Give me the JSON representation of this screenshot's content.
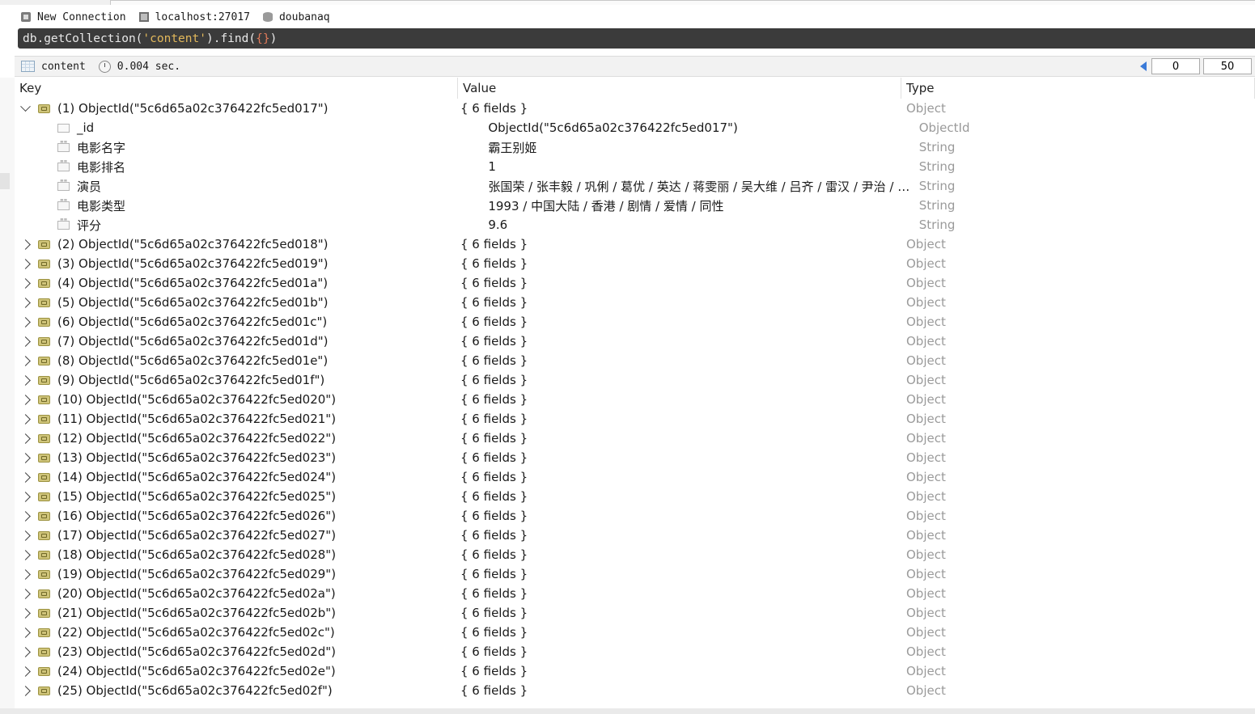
{
  "connection": {
    "name": "New Connection",
    "host": "localhost:27017",
    "database": "doubanaq"
  },
  "query": {
    "prefix": "db.getCollection(",
    "arg": "'content'",
    "mid": ").find(",
    "open_brace": "{",
    "close_brace": "}",
    "suffix": ")"
  },
  "result": {
    "collection": "content",
    "time": "0.004 sec.",
    "page_start": "0",
    "page_size": "50"
  },
  "columns": {
    "key": "Key",
    "value": "Value",
    "type": "Type"
  },
  "expanded_document": {
    "key": "(1) ObjectId(\"5c6d65a02c376422fc5ed017\")",
    "value": "{ 6 fields }",
    "type": "Object",
    "fields": [
      {
        "key": "_id",
        "value": "ObjectId(\"5c6d65a02c376422fc5ed017\")",
        "type": "ObjectId",
        "icon": "id-icon"
      },
      {
        "key": "电影名字",
        "value": "霸王别姬",
        "type": "String",
        "icon": "string-icon"
      },
      {
        "key": "电影排名",
        "value": "1",
        "type": "String",
        "icon": "string-icon"
      },
      {
        "key": "演员",
        "value": "张国荣 / 张丰毅 / 巩俐 / 葛优 / 英达 / 蒋雯丽 / 吴大维 / 吕齐 / 雷汉 / 尹治 / 马…",
        "type": "String",
        "icon": "string-icon"
      },
      {
        "key": "电影类型",
        "value": "1993 / 中国大陆 / 香港 / 剧情 / 爱情 / 同性",
        "type": "String",
        "icon": "string-icon"
      },
      {
        "key": "评分",
        "value": "9.6",
        "type": "String",
        "icon": "string-icon"
      }
    ]
  },
  "documents": [
    {
      "key": "(2) ObjectId(\"5c6d65a02c376422fc5ed018\")",
      "value": "{ 6 fields }",
      "type": "Object"
    },
    {
      "key": "(3) ObjectId(\"5c6d65a02c376422fc5ed019\")",
      "value": "{ 6 fields }",
      "type": "Object"
    },
    {
      "key": "(4) ObjectId(\"5c6d65a02c376422fc5ed01a\")",
      "value": "{ 6 fields }",
      "type": "Object"
    },
    {
      "key": "(5) ObjectId(\"5c6d65a02c376422fc5ed01b\")",
      "value": "{ 6 fields }",
      "type": "Object"
    },
    {
      "key": "(6) ObjectId(\"5c6d65a02c376422fc5ed01c\")",
      "value": "{ 6 fields }",
      "type": "Object"
    },
    {
      "key": "(7) ObjectId(\"5c6d65a02c376422fc5ed01d\")",
      "value": "{ 6 fields }",
      "type": "Object"
    },
    {
      "key": "(8) ObjectId(\"5c6d65a02c376422fc5ed01e\")",
      "value": "{ 6 fields }",
      "type": "Object"
    },
    {
      "key": "(9) ObjectId(\"5c6d65a02c376422fc5ed01f\")",
      "value": "{ 6 fields }",
      "type": "Object"
    },
    {
      "key": "(10) ObjectId(\"5c6d65a02c376422fc5ed020\")",
      "value": "{ 6 fields }",
      "type": "Object"
    },
    {
      "key": "(11) ObjectId(\"5c6d65a02c376422fc5ed021\")",
      "value": "{ 6 fields }",
      "type": "Object"
    },
    {
      "key": "(12) ObjectId(\"5c6d65a02c376422fc5ed022\")",
      "value": "{ 6 fields }",
      "type": "Object"
    },
    {
      "key": "(13) ObjectId(\"5c6d65a02c376422fc5ed023\")",
      "value": "{ 6 fields }",
      "type": "Object"
    },
    {
      "key": "(14) ObjectId(\"5c6d65a02c376422fc5ed024\")",
      "value": "{ 6 fields }",
      "type": "Object"
    },
    {
      "key": "(15) ObjectId(\"5c6d65a02c376422fc5ed025\")",
      "value": "{ 6 fields }",
      "type": "Object"
    },
    {
      "key": "(16) ObjectId(\"5c6d65a02c376422fc5ed026\")",
      "value": "{ 6 fields }",
      "type": "Object"
    },
    {
      "key": "(17) ObjectId(\"5c6d65a02c376422fc5ed027\")",
      "value": "{ 6 fields }",
      "type": "Object"
    },
    {
      "key": "(18) ObjectId(\"5c6d65a02c376422fc5ed028\")",
      "value": "{ 6 fields }",
      "type": "Object"
    },
    {
      "key": "(19) ObjectId(\"5c6d65a02c376422fc5ed029\")",
      "value": "{ 6 fields }",
      "type": "Object"
    },
    {
      "key": "(20) ObjectId(\"5c6d65a02c376422fc5ed02a\")",
      "value": "{ 6 fields }",
      "type": "Object"
    },
    {
      "key": "(21) ObjectId(\"5c6d65a02c376422fc5ed02b\")",
      "value": "{ 6 fields }",
      "type": "Object"
    },
    {
      "key": "(22) ObjectId(\"5c6d65a02c376422fc5ed02c\")",
      "value": "{ 6 fields }",
      "type": "Object"
    },
    {
      "key": "(23) ObjectId(\"5c6d65a02c376422fc5ed02d\")",
      "value": "{ 6 fields }",
      "type": "Object"
    },
    {
      "key": "(24) ObjectId(\"5c6d65a02c376422fc5ed02e\")",
      "value": "{ 6 fields }",
      "type": "Object"
    },
    {
      "key": "(25) ObjectId(\"5c6d65a02c376422fc5ed02f\")",
      "value": "{ 6 fields }",
      "type": "Object"
    }
  ]
}
